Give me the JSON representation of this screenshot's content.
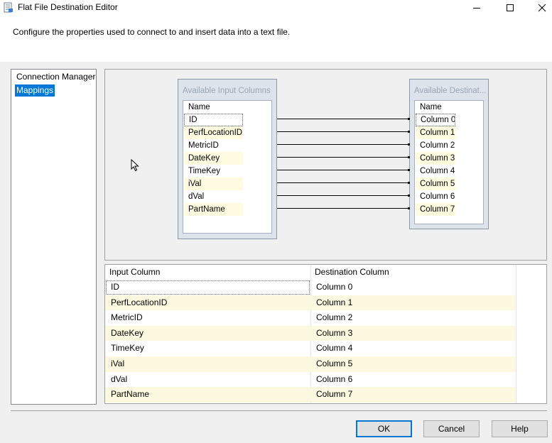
{
  "window": {
    "title": "Flat File Destination Editor",
    "description": "Configure the properties used to connect to and insert data into a text file."
  },
  "nav": {
    "items": [
      {
        "label": "Connection Manager",
        "selected": false
      },
      {
        "label": "Mappings",
        "selected": true
      }
    ]
  },
  "mapping": {
    "input_box": {
      "title": "Available Input Columns",
      "header": "Name",
      "columns": [
        "ID",
        "PerfLocationID",
        "MetricID",
        "DateKey",
        "TimeKey",
        "iVal",
        "dVal",
        "PartName"
      ]
    },
    "dest_box": {
      "title": "Available Destinat...",
      "header": "Name",
      "columns": [
        "Column 0",
        "Column 1",
        "Column 2",
        "Column 3",
        "Column 4",
        "Column 5",
        "Column 6",
        "Column 7"
      ]
    }
  },
  "grid": {
    "headers": {
      "input": "Input Column",
      "dest": "Destination Column"
    },
    "rows": [
      {
        "input": "ID",
        "dest": "Column 0"
      },
      {
        "input": "PerfLocationID",
        "dest": "Column 1"
      },
      {
        "input": "MetricID",
        "dest": "Column 2"
      },
      {
        "input": "DateKey",
        "dest": "Column 3"
      },
      {
        "input": "TimeKey",
        "dest": "Column 4"
      },
      {
        "input": "iVal",
        "dest": "Column 5"
      },
      {
        "input": "dVal",
        "dest": "Column 6"
      },
      {
        "input": "PartName",
        "dest": "Column 7"
      }
    ]
  },
  "buttons": {
    "ok": "OK",
    "cancel": "Cancel",
    "help": "Help"
  },
  "colors": {
    "accent": "#0078d7",
    "alt_row": "#fdf9e0"
  },
  "icons": [
    "app-icon",
    "minimize-icon",
    "maximize-icon",
    "close-icon",
    "mouse-cursor-icon"
  ]
}
